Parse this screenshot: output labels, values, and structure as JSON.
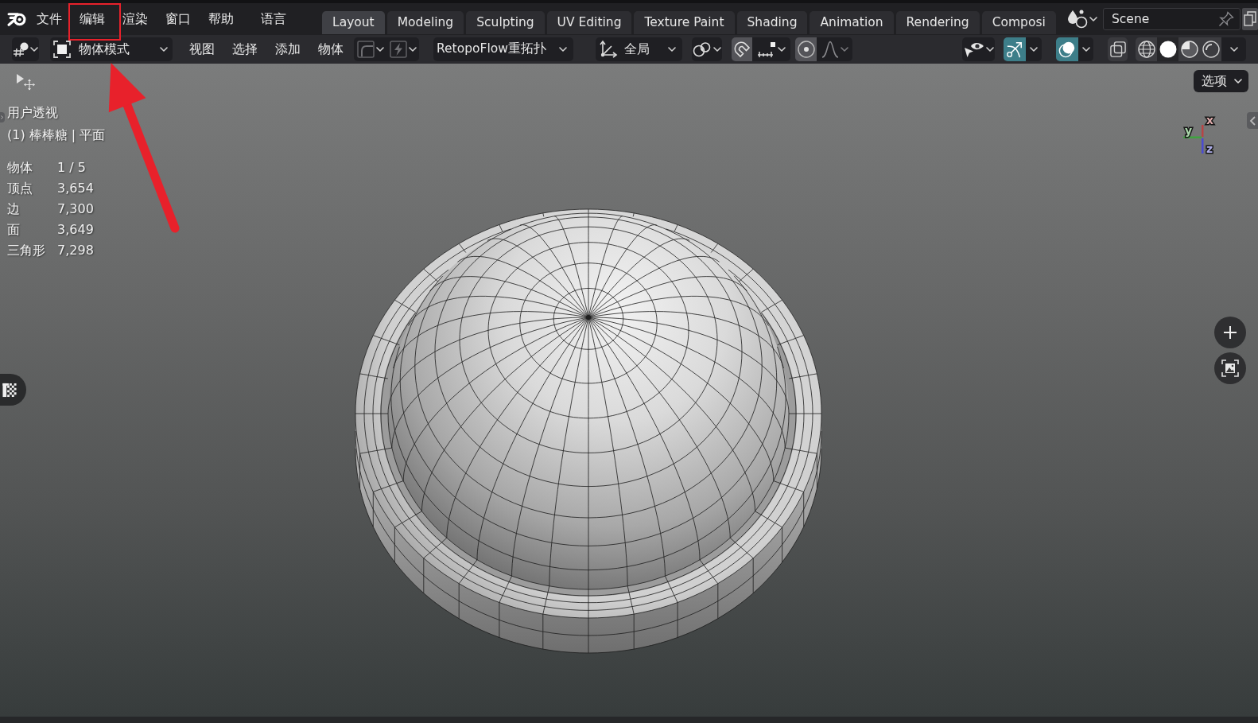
{
  "menubar": [
    {
      "label": "文件",
      "highlighted": false
    },
    {
      "label": "编辑",
      "highlighted": true
    },
    {
      "label": "渲染",
      "highlighted": false
    },
    {
      "label": "窗口",
      "highlighted": false
    },
    {
      "label": "帮助",
      "highlighted": false
    },
    {
      "label": "语言",
      "highlighted": false
    }
  ],
  "workspace_tabs": [
    {
      "label": "Layout",
      "selected": true
    },
    {
      "label": "Modeling",
      "selected": false
    },
    {
      "label": "Sculpting",
      "selected": false
    },
    {
      "label": "UV Editing",
      "selected": false
    },
    {
      "label": "Texture Paint",
      "selected": false
    },
    {
      "label": "Shading",
      "selected": false
    },
    {
      "label": "Animation",
      "selected": false
    },
    {
      "label": "Rendering",
      "selected": false
    },
    {
      "label": "Composi",
      "selected": false
    }
  ],
  "scene": "Scene",
  "header": {
    "mode": "物体模式",
    "menus": [
      "视图",
      "选择",
      "添加",
      "物体"
    ],
    "addon_menu": "RetopoFlow重拓扑",
    "orientation": "全局",
    "snapping": true,
    "proportional_editing": true,
    "show_gizmos": true,
    "show_overlays": true,
    "xray": false,
    "shading": [
      {
        "kind": "wireframe",
        "selected": false
      },
      {
        "kind": "solid",
        "selected": true
      },
      {
        "kind": "material",
        "selected": false
      },
      {
        "kind": "rendered",
        "selected": false
      }
    ]
  },
  "viewport": {
    "view_name": "用户透视",
    "object_info": "(1) 棒棒糖 | 平面",
    "stats": [
      {
        "label": "物体",
        "value": "1 / 5"
      },
      {
        "label": "顶点",
        "value": "3,654"
      },
      {
        "label": "边",
        "value": "7,300"
      },
      {
        "label": "面",
        "value": "3,649"
      },
      {
        "label": "三角形",
        "value": "7,298"
      }
    ],
    "options_button": "选项",
    "axes": [
      {
        "label": "x",
        "color": "#b84444"
      },
      {
        "label": "y",
        "color": "#3fa33f"
      },
      {
        "label": "z",
        "color": "#4a4ad2"
      }
    ]
  }
}
